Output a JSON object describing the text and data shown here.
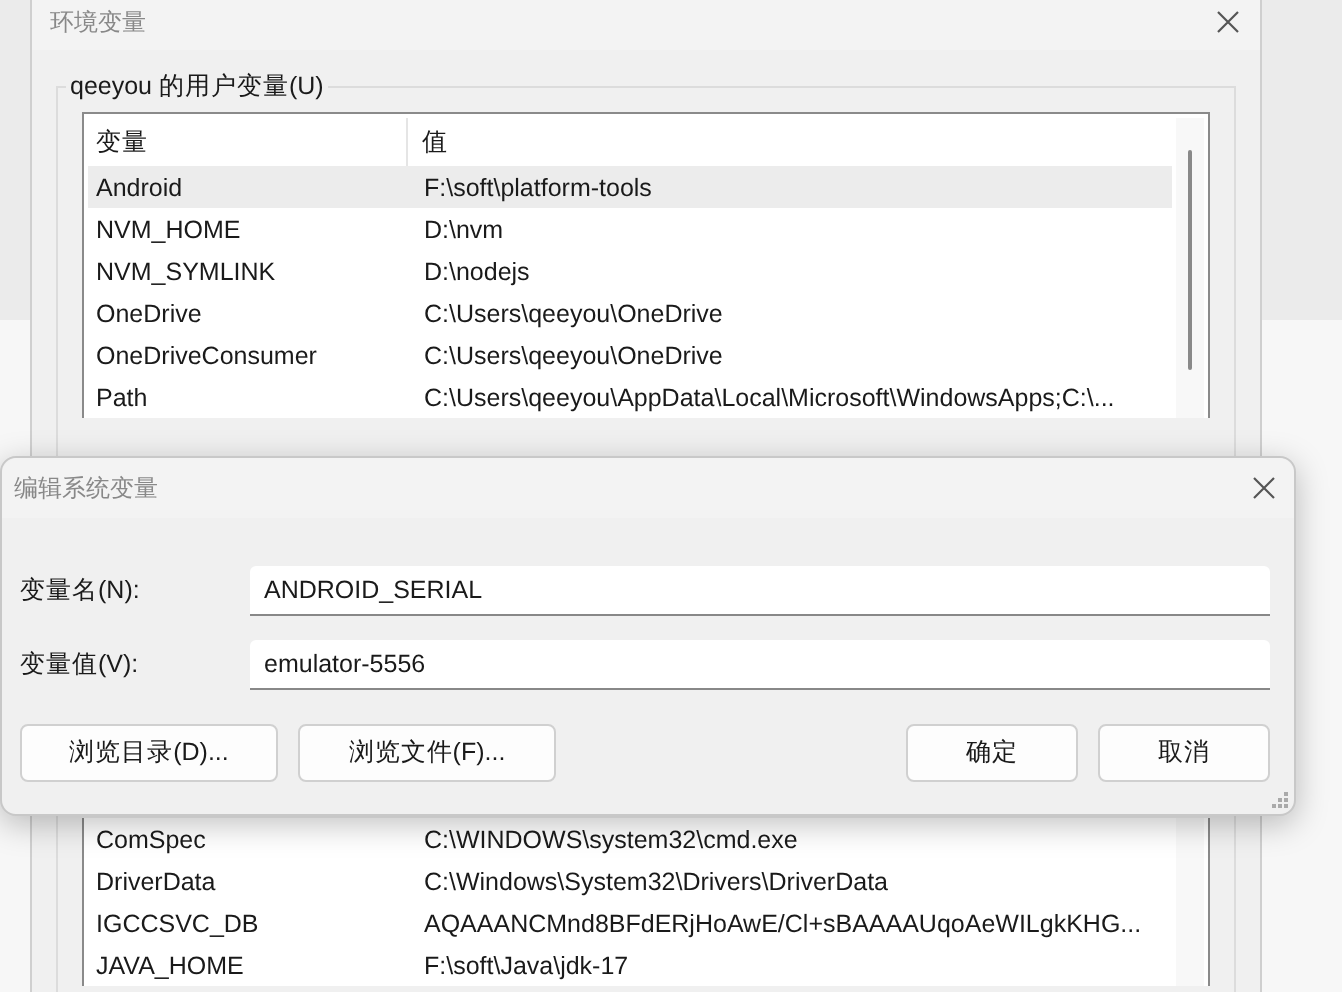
{
  "background_window": {
    "title": "环境变量",
    "user_variables": {
      "label": "qeeyou 的用户变量(U)",
      "columns": [
        "变量",
        "值"
      ],
      "rows": [
        {
          "name": "Android",
          "value": "F:\\soft\\platform-tools",
          "selected": true
        },
        {
          "name": "NVM_HOME",
          "value": "D:\\nvm",
          "selected": false
        },
        {
          "name": "NVM_SYMLINK",
          "value": "D:\\nodejs",
          "selected": false
        },
        {
          "name": "OneDrive",
          "value": "C:\\Users\\qeeyou\\OneDrive",
          "selected": false
        },
        {
          "name": "OneDriveConsumer",
          "value": "C:\\Users\\qeeyou\\OneDrive",
          "selected": false
        },
        {
          "name": "Path",
          "value": "C:\\Users\\qeeyou\\AppData\\Local\\Microsoft\\WindowsApps;C:\\...",
          "selected": false
        }
      ]
    },
    "system_variables": {
      "rows": [
        {
          "name": "ComSpec",
          "value": "C:\\WINDOWS\\system32\\cmd.exe",
          "selected": false
        },
        {
          "name": "DriverData",
          "value": "C:\\Windows\\System32\\Drivers\\DriverData",
          "selected": false
        },
        {
          "name": "IGCCSVC_DB",
          "value": "AQAAANCMnd8BFdERjHoAwE/Cl+sBAAAAUqoAeWILgkKHG...",
          "selected": false
        },
        {
          "name": "JAVA_HOME",
          "value": "F:\\soft\\Java\\jdk-17",
          "selected": false
        }
      ]
    }
  },
  "dialog": {
    "title": "编辑系统变量",
    "fields": [
      {
        "label": "变量名(N):",
        "value": "ANDROID_SERIAL"
      },
      {
        "label": "变量值(V):",
        "value": "emulator-5556"
      }
    ],
    "left_buttons": [
      "浏览目录(D)...",
      "浏览文件(F)..."
    ],
    "right_buttons": [
      "确定",
      "取消"
    ]
  }
}
